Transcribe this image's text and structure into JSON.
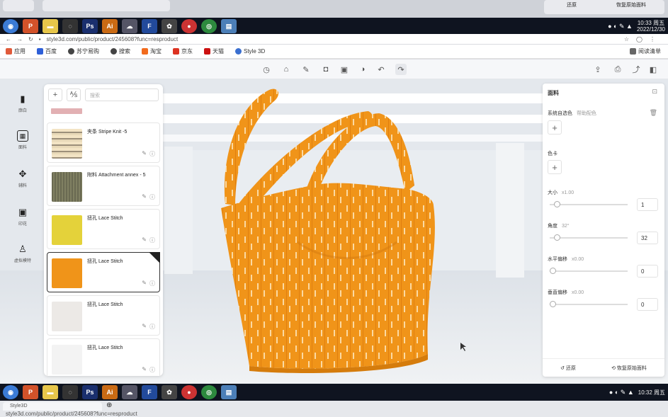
{
  "top_taskbar": {
    "clock_time": "10:33 周五",
    "clock_date": "2022/12/30"
  },
  "top_strip": {
    "restore_label": "还原",
    "reset_label": "恢复原始面料"
  },
  "browser": {
    "url": "style3d.com/public/product/245608?func=resproduct",
    "bookmarks": [
      "应用",
      "百度",
      "苏宁易购",
      "搜索",
      "淘宝",
      "京东",
      "天猫",
      "Style 3D"
    ],
    "reading_list": "阅读清单"
  },
  "left_rail": {
    "items": [
      {
        "label": "廓白",
        "icon": "box-icon"
      },
      {
        "label": "面料",
        "icon": "grid-icon"
      },
      {
        "label": "辅料",
        "icon": "button-icon"
      },
      {
        "label": "印花",
        "icon": "image-icon"
      },
      {
        "label": "虚拟模特",
        "icon": "mannequin-icon"
      }
    ]
  },
  "fabric_panel": {
    "search_placeholder": "搜索",
    "cards": [
      {
        "name": "夹条 Stripe Knit -5",
        "swatch": "#c9b78e",
        "selected": false
      },
      {
        "name": "附料 Attachment annex - 5",
        "swatch": "#6a6a52",
        "selected": false
      },
      {
        "name": "扭孔 Lace Stitch",
        "swatch": "#e4d23a",
        "selected": false
      },
      {
        "name": "扭孔 Lace Stitch",
        "swatch": "#f09419",
        "selected": true
      },
      {
        "name": "扭孔 Lace Stitch",
        "swatch": "#ece9e6",
        "selected": false
      },
      {
        "name": "扭孔 Lace Stitch",
        "swatch": "#f3f3f3",
        "selected": false
      }
    ]
  },
  "right_panel": {
    "title": "面料",
    "system_color_label": "系统自选色",
    "system_color_sub": "帮助配色",
    "palette_label": "色卡",
    "size_label": "大小",
    "size_sub": "x1.00",
    "size_value": "1",
    "size_fraction": 0.05,
    "angle_label": "角度",
    "angle_sub": "32°",
    "angle_value": "32",
    "angle_fraction": 0.05,
    "hshift_label": "水平偏移",
    "hshift_sub": "x0.00",
    "hshift_value": "0",
    "hshift_fraction": 0.0,
    "vshift_label": "垂直偏移",
    "vshift_sub": "x0.00",
    "vshift_value": "0",
    "vshift_fraction": 0.0,
    "restore_label": "还原",
    "reset_label": "恢复原始面料"
  },
  "bottom_taskbar": {
    "clock_time": "10:32 周五"
  },
  "bottom_browser": {
    "tab_title": "Style3D",
    "url": "style3d.com/public/product/245608?func=resproduct"
  },
  "colors": {
    "accent": "#f09419",
    "taskbar": "#0f1420"
  }
}
